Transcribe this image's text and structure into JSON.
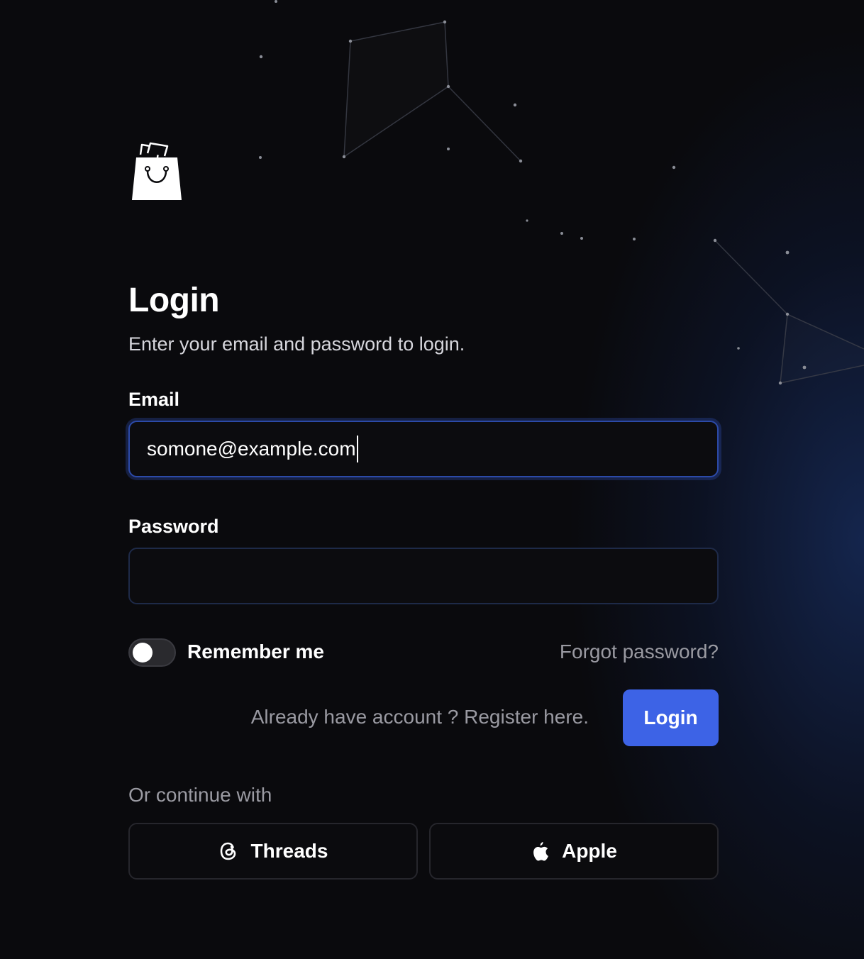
{
  "page": {
    "title": "Login",
    "subtitle": "Enter your email and password to login."
  },
  "logo": {
    "icon": "shopping-bag-icon"
  },
  "form": {
    "email_label": "Email",
    "email_value": "somone@example.com",
    "password_label": "Password",
    "password_value": "",
    "remember_label": "Remember me",
    "remember_checked": false,
    "forgot_link": "Forgot password?",
    "register_link": "Already have account ? Register here.",
    "login_button": "Login"
  },
  "social": {
    "heading": "Or continue with",
    "providers": [
      {
        "label": "Threads",
        "icon": "threads-icon"
      },
      {
        "label": "Apple",
        "icon": "apple-icon"
      }
    ]
  },
  "colors": {
    "background": "#0a0a0d",
    "accent": "#3d63e6",
    "focus_border": "#2c4aa8",
    "muted_text": "#9a9aa2"
  }
}
